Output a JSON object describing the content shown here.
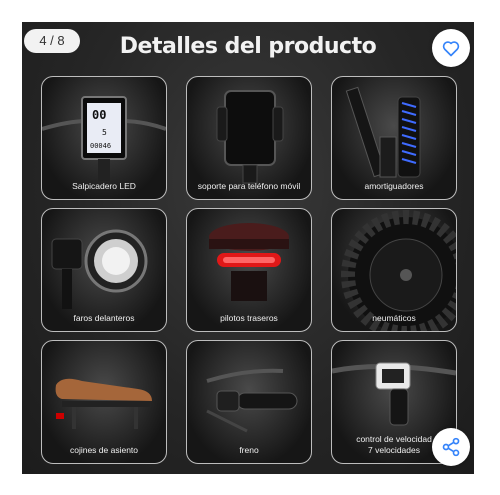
{
  "gallery": {
    "counter": "4 / 8",
    "title": "Detalles del producto",
    "accent_color": "#3483fa",
    "favorite_icon": "heart-outline-icon",
    "share_icon": "share-icon",
    "tiles": [
      {
        "caption": "Salpicadero LED",
        "lcd": {
          "speed": "00",
          "level": "5",
          "odo": "00046"
        }
      },
      {
        "caption": "soporte para teléfono móvil"
      },
      {
        "caption": "amortiguadores"
      },
      {
        "caption": "faros delanteros"
      },
      {
        "caption": "pilotos traseros"
      },
      {
        "caption": "neumáticos"
      },
      {
        "caption": "cojines de asiento"
      },
      {
        "caption": "freno"
      },
      {
        "caption_line1": "control de velocidad",
        "caption_line2": "7 velocidades"
      }
    ]
  }
}
